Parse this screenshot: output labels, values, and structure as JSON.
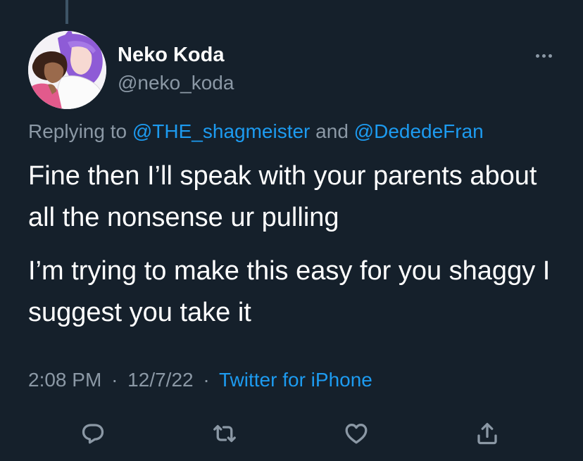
{
  "tweet": {
    "author": {
      "display_name": "Neko Koda",
      "handle": "@neko_koda",
      "avatar_icon": "cartoon-avatar-icon"
    },
    "reply_context": {
      "prefix": "Replying to",
      "mentions": [
        "@THE_shagmeister",
        "@DededeFran"
      ],
      "joiner": "and"
    },
    "paragraphs": [
      "Fine then I’ll speak with your parents about all the nonsense ur pulling",
      "I’m trying to make this easy for you shaggy I suggest you take it"
    ],
    "meta": {
      "time": "2:08 PM",
      "separator": "·",
      "date": "12/7/22",
      "source": "Twitter for iPhone"
    },
    "actions": [
      {
        "name": "reply",
        "icon": "reply-icon"
      },
      {
        "name": "retweet",
        "icon": "retweet-icon"
      },
      {
        "name": "like",
        "icon": "heart-icon"
      },
      {
        "name": "share",
        "icon": "share-icon"
      }
    ],
    "more_icon": "more-options-icon"
  },
  "colors": {
    "background": "#15202b",
    "primary_text": "#ffffff",
    "secondary_text": "#8b98a5",
    "link": "#1d9bf0",
    "thread_line": "#3d5466"
  }
}
